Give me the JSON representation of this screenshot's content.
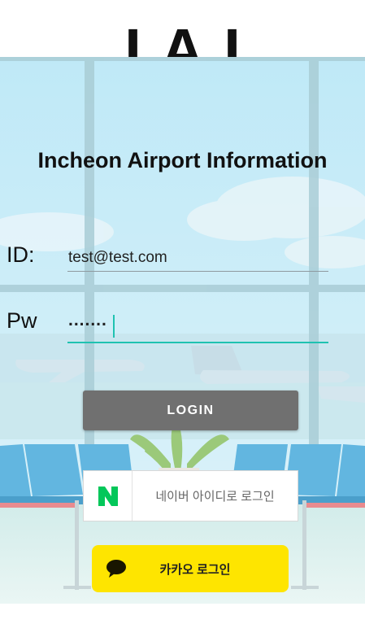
{
  "app": {
    "logo_text": "IAI",
    "subtitle": "Incheon Airport Information"
  },
  "form": {
    "id_label": "ID:",
    "id_value": "test@test.com",
    "pw_label": "Pw",
    "pw_value": "......."
  },
  "buttons": {
    "login_label": "LOGIN",
    "naver_label": "네이버 아이디로 로그인",
    "naver_icon_text": "N",
    "kakao_label": "카카오 로그인"
  },
  "colors": {
    "accent": "#1fc2b1",
    "login_button": "#707070",
    "naver_green": "#03c75a",
    "kakao_yellow": "#fee500",
    "sky": "#bfe6f5"
  },
  "icons": {
    "naver": "naver-n-icon",
    "kakao": "kakao-chat-bubble-icon"
  }
}
